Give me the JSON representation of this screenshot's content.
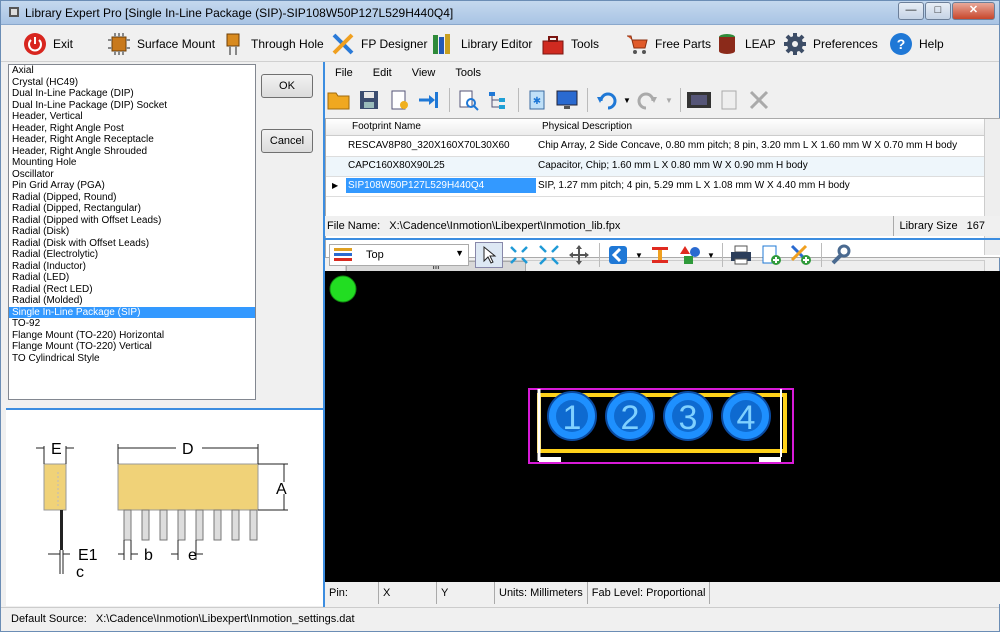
{
  "window": {
    "title": "Library Expert Pro [Single In-Line Package (SIP)-SIP108W50P127L529H440Q4]",
    "minimize": "—",
    "maximize": "□",
    "close": "✕"
  },
  "main_toolbar": {
    "exit": "Exit",
    "surface_mount": "Surface Mount",
    "through_hole": "Through Hole",
    "fp_designer": "FP Designer",
    "library_editor": "Library Editor",
    "tools": "Tools",
    "free_parts": "Free Parts",
    "leap": "LEAP",
    "preferences": "Preferences",
    "help": "Help"
  },
  "package_list": {
    "items": [
      "Axial",
      "Crystal (HC49)",
      "Dual In-Line Package (DIP)",
      "Dual In-Line Package (DIP) Socket",
      "Header, Vertical",
      "Header, Right Angle Post",
      "Header, Right Angle Receptacle",
      "Header, Right Angle Shrouded",
      "Mounting Hole",
      "Oscillator",
      "Pin Grid Array (PGA)",
      "Radial (Dipped, Round)",
      "Radial (Dipped, Rectangular)",
      "Radial (Dipped with Offset Leads)",
      "Radial (Disk)",
      "Radial (Disk with Offset Leads)",
      "Radial (Electrolytic)",
      "Radial (Inductor)",
      "Radial (LED)",
      "Radial (Rect LED)",
      "Radial (Molded)",
      "Single In-Line Package (SIP)",
      "TO-92",
      "Flange Mount (TO-220) Horizontal",
      "Flange Mount (TO-220) Vertical",
      "TO Cylindrical Style"
    ],
    "selected_index": 21
  },
  "buttons": {
    "ok": "OK",
    "cancel": "Cancel"
  },
  "diagram": {
    "E": "E",
    "D": "D",
    "A": "A",
    "E1": "E1",
    "c": "c",
    "b": "b",
    "e": "e"
  },
  "menu": {
    "file": "File",
    "edit": "Edit",
    "view": "View",
    "tools": "Tools"
  },
  "grid": {
    "headers": [
      "Footprint Name",
      "Physical Description"
    ],
    "rows": [
      [
        "RESCAV8P80_320X160X70L30X60",
        "Chip Array, 2 Side Concave, 0.80 mm pitch; 8 pin, 3.20 mm L X 1.60 mm W X 0.70 mm H body"
      ],
      [
        "CAPC160X80X90L25",
        "Capacitor, Chip; 1.60 mm L X 0.80 mm W X 0.90 mm H body"
      ],
      [
        "SIP108W50P127L529H440Q4",
        "SIP, 1.27 mm pitch; 4 pin, 5.29 mm L X 1.08 mm W X 4.40 mm H body"
      ]
    ],
    "row_marker": "▶",
    "scroll_thumb": "III"
  },
  "file_info": {
    "label": "File Name:",
    "path": "X:\\Cadence\\Inmotion\\Libexpert\\Inmotion_lib.fpx",
    "lib_size_label": "Library Size",
    "lib_size_value": "167"
  },
  "view_toolbar": {
    "layer": "Top",
    "dropdown_arrow": "▼"
  },
  "pads": [
    "1",
    "2",
    "3",
    "4"
  ],
  "status": {
    "pin": "Pin:",
    "x": "X",
    "y": "Y",
    "units": "Units: Millimeters",
    "fab": "Fab Level: Proportional"
  },
  "footer": {
    "label": "Default Source:",
    "path": "X:\\Cadence\\Inmotion\\Libexpert\\Inmotion_settings.dat"
  },
  "colors": {
    "selection": "#3399ff",
    "pad_fill": "#1e90ff",
    "silkscreen": "#ffd21a",
    "courtyard": "#d81bd8",
    "origin_marker": "#22dd22",
    "body_fill": "#f0d278",
    "accent_border": "#3c8de0"
  }
}
